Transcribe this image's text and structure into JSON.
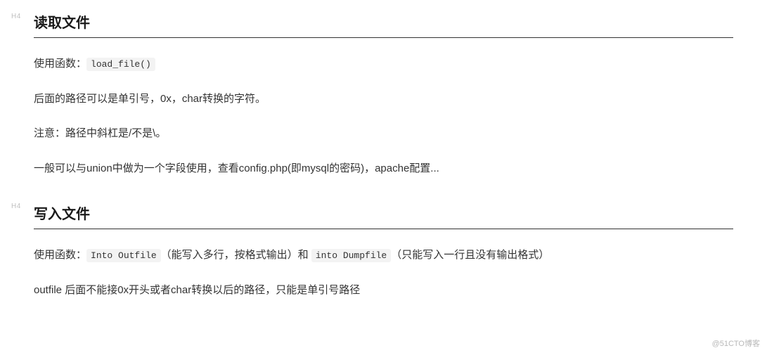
{
  "tags": {
    "h4_label": "H4"
  },
  "section1": {
    "heading": "读取文件",
    "p1_prefix": "使用函数：",
    "p1_code": "load_file()",
    "p2": "后面的路径可以是单引号，0x，char转换的字符。",
    "p3": "注意：路径中斜杠是/不是\\。",
    "p4": "一般可以与union中做为一个字段使用，查看config.php(即mysql的密码)，apache配置..."
  },
  "section2": {
    "heading": "写入文件",
    "p1_prefix": "使用函数：",
    "p1_code1": "Into Outfile",
    "p1_mid1": "（能写入多行，按格式输出）和 ",
    "p1_code2": "into Dumpfile",
    "p1_suffix": "（只能写入一行且没有输出格式）",
    "p2": "outfile 后面不能接0x开头或者char转换以后的路径，只能是单引号路径"
  },
  "watermark": "@51CTO博客"
}
